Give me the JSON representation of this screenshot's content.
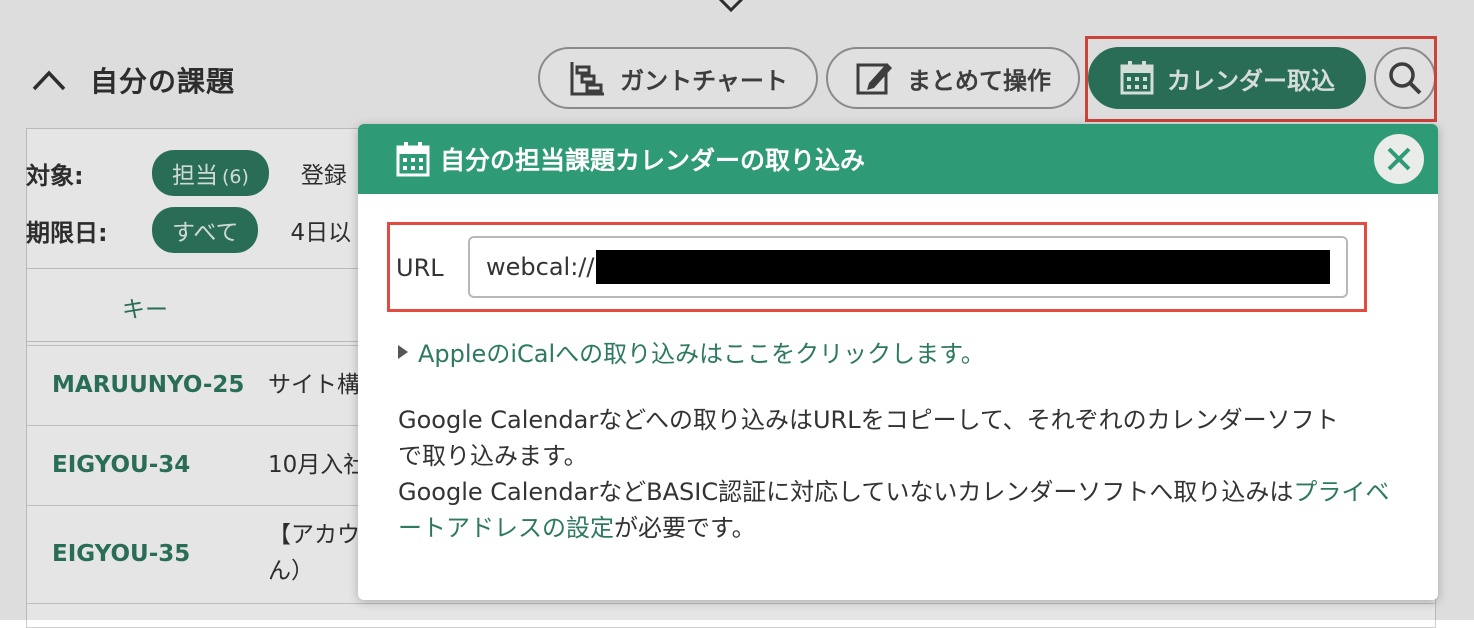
{
  "section": {
    "title": "自分の課題"
  },
  "toolbar": {
    "gantt_label": "ガントチャート",
    "bulk_label": "まとめて操作",
    "calendar_label": "カレンダー取込"
  },
  "filters": {
    "target_label": "対象:",
    "target_chip": "担当",
    "target_count": "(6)",
    "target_extra": "登録",
    "deadline_label": "期限日:",
    "deadline_chip": "すべて",
    "deadline_extra": "4日以"
  },
  "table": {
    "key_header": "キー",
    "rows": [
      {
        "key": "MARUUNYO-25",
        "summary": "サイト構"
      },
      {
        "key": "EIGYOU-34",
        "summary": "10月入社"
      },
      {
        "key": "EIGYOU-35",
        "summary_line1": "【アカウ",
        "summary_line2": "ん）"
      }
    ]
  },
  "modal": {
    "title": "自分の担当課題カレンダーの取り込み",
    "url_label": "URL",
    "url_value": "webcal://",
    "ical_link": "AppleのiCalへの取り込みはここをクリックします。",
    "desc_line1": "Google Calendarなどへの取り込みはURLをコピーして、それぞれのカレンダーソフト",
    "desc_line2": "で取り込みます。",
    "desc_line3_prefix": "Google CalendarなどBASIC認証に対応していないカレンダーソフトへ取り込みは",
    "desc_link": "プライベートアドレスの設定",
    "desc_line3_suffix": "が必要です。"
  },
  "colors": {
    "accent": "#2e7a60",
    "modal_header": "#2f9a76",
    "highlight": "#e34b40"
  }
}
